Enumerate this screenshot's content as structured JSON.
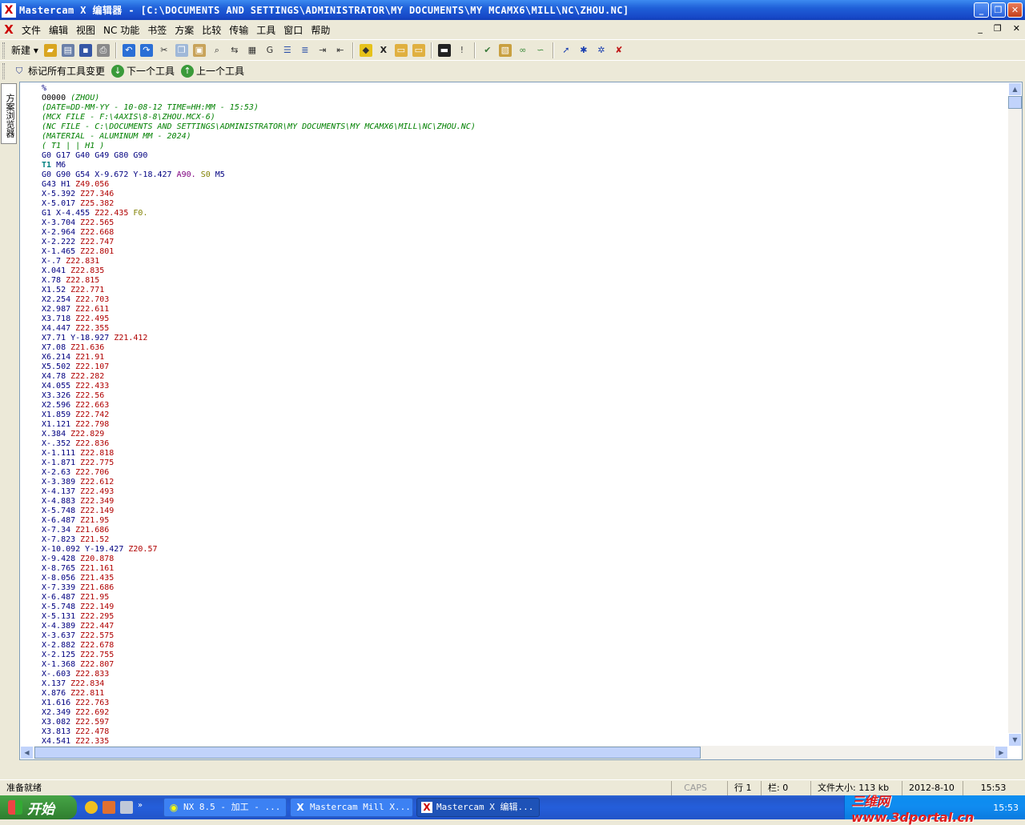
{
  "window": {
    "title": "Mastercam X 编辑器 - [C:\\DOCUMENTS AND SETTINGS\\ADMINISTRATOR\\MY DOCUMENTS\\MY MCAMX6\\MILL\\NC\\ZHOU.NC]",
    "min": "_",
    "restore": "❐",
    "close": "✕"
  },
  "menu": {
    "items": [
      "文件",
      "编辑",
      "视图",
      "NC 功能",
      "书签",
      "方案",
      "比较",
      "传输",
      "工具",
      "窗口",
      "帮助"
    ],
    "mdi": [
      "_",
      "❐",
      "✕"
    ]
  },
  "toolbar": {
    "new_label": "新建"
  },
  "toolbar2": {
    "mark_all": "标记所有工具变更",
    "next_tool": "下一个工具",
    "prev_tool": "上一个工具"
  },
  "side_panel": {
    "tab_label": "方案浏览器"
  },
  "colors": {
    "address": "#000080",
    "xcoord": "#000080",
    "zcoord": "#b00000",
    "comment": "#008000",
    "tool": "#008080",
    "feed": "#808000",
    "arc": "#800080",
    "sword": "#808000"
  },
  "code_lines": [
    [
      [
        "%",
        "#000080"
      ]
    ],
    [
      [
        "O0000 ",
        "#000000"
      ],
      [
        "(ZHOU)",
        "#008000"
      ]
    ],
    [
      [
        "(DATE=DD-MM-YY - 10-08-12 TIME=HH:MM - 15:53)",
        "#008000"
      ]
    ],
    [
      [
        "(MCX FILE - F:\\4AXIS\\8-8\\ZHOU.MCX-6)",
        "#008000"
      ]
    ],
    [
      [
        "(NC FILE - C:\\DOCUMENTS AND SETTINGS\\ADMINISTRATOR\\MY DOCUMENTS\\MY MCAMX6\\MILL\\NC\\ZHOU.NC)",
        "#008000"
      ]
    ],
    [
      [
        "(MATERIAL - ALUMINUM MM - 2024)",
        "#008000"
      ]
    ],
    [
      [
        "( T1 | | H1 )",
        "#008000"
      ]
    ],
    [
      [
        "G0 G17 G40 G49 G80 G90",
        "#000080"
      ]
    ],
    [
      [
        "T1",
        "#008080"
      ],
      [
        " M6",
        "#000080"
      ]
    ],
    [
      [
        "G0 G90 G54 X-9.672 Y-18.427 ",
        "#000080"
      ],
      [
        "A90.",
        "#800080"
      ],
      [
        " S0",
        "#808000"
      ],
      [
        " M5",
        "#000080"
      ]
    ],
    [
      [
        "G43 H1 ",
        "#000080"
      ],
      [
        "Z49.056",
        "#b00000"
      ]
    ],
    [
      [
        "X-5.392 ",
        "#000080"
      ],
      [
        "Z27.346",
        "#b00000"
      ]
    ],
    [
      [
        "X-5.017 ",
        "#000080"
      ],
      [
        "Z25.382",
        "#b00000"
      ]
    ],
    [
      [
        "G1 X-4.455 ",
        "#000080"
      ],
      [
        "Z22.435",
        "#b00000"
      ],
      [
        " F0.",
        "#808000"
      ]
    ],
    [
      [
        "X-3.704 ",
        "#000080"
      ],
      [
        "Z22.565",
        "#b00000"
      ]
    ],
    [
      [
        "X-2.964 ",
        "#000080"
      ],
      [
        "Z22.668",
        "#b00000"
      ]
    ],
    [
      [
        "X-2.222 ",
        "#000080"
      ],
      [
        "Z22.747",
        "#b00000"
      ]
    ],
    [
      [
        "X-1.465 ",
        "#000080"
      ],
      [
        "Z22.801",
        "#b00000"
      ]
    ],
    [
      [
        "X-.7 ",
        "#000080"
      ],
      [
        "Z22.831",
        "#b00000"
      ]
    ],
    [
      [
        "X.041 ",
        "#000080"
      ],
      [
        "Z22.835",
        "#b00000"
      ]
    ],
    [
      [
        "X.78 ",
        "#000080"
      ],
      [
        "Z22.815",
        "#b00000"
      ]
    ],
    [
      [
        "X1.52 ",
        "#000080"
      ],
      [
        "Z22.771",
        "#b00000"
      ]
    ],
    [
      [
        "X2.254 ",
        "#000080"
      ],
      [
        "Z22.703",
        "#b00000"
      ]
    ],
    [
      [
        "X2.987 ",
        "#000080"
      ],
      [
        "Z22.611",
        "#b00000"
      ]
    ],
    [
      [
        "X3.718 ",
        "#000080"
      ],
      [
        "Z22.495",
        "#b00000"
      ]
    ],
    [
      [
        "X4.447 ",
        "#000080"
      ],
      [
        "Z22.355",
        "#b00000"
      ]
    ],
    [
      [
        "X7.71 Y-18.927 ",
        "#000080"
      ],
      [
        "Z21.412",
        "#b00000"
      ]
    ],
    [
      [
        "X7.08 ",
        "#000080"
      ],
      [
        "Z21.636",
        "#b00000"
      ]
    ],
    [
      [
        "X6.214 ",
        "#000080"
      ],
      [
        "Z21.91",
        "#b00000"
      ]
    ],
    [
      [
        "X5.502 ",
        "#000080"
      ],
      [
        "Z22.107",
        "#b00000"
      ]
    ],
    [
      [
        "X4.78 ",
        "#000080"
      ],
      [
        "Z22.282",
        "#b00000"
      ]
    ],
    [
      [
        "X4.055 ",
        "#000080"
      ],
      [
        "Z22.433",
        "#b00000"
      ]
    ],
    [
      [
        "X3.326 ",
        "#000080"
      ],
      [
        "Z22.56",
        "#b00000"
      ]
    ],
    [
      [
        "X2.596 ",
        "#000080"
      ],
      [
        "Z22.663",
        "#b00000"
      ]
    ],
    [
      [
        "X1.859 ",
        "#000080"
      ],
      [
        "Z22.742",
        "#b00000"
      ]
    ],
    [
      [
        "X1.121 ",
        "#000080"
      ],
      [
        "Z22.798",
        "#b00000"
      ]
    ],
    [
      [
        "X.384 ",
        "#000080"
      ],
      [
        "Z22.829",
        "#b00000"
      ]
    ],
    [
      [
        "X-.352 ",
        "#000080"
      ],
      [
        "Z22.836",
        "#b00000"
      ]
    ],
    [
      [
        "X-1.111 ",
        "#000080"
      ],
      [
        "Z22.818",
        "#b00000"
      ]
    ],
    [
      [
        "X-1.871 ",
        "#000080"
      ],
      [
        "Z22.775",
        "#b00000"
      ]
    ],
    [
      [
        "X-2.63 ",
        "#000080"
      ],
      [
        "Z22.706",
        "#b00000"
      ]
    ],
    [
      [
        "X-3.389 ",
        "#000080"
      ],
      [
        "Z22.612",
        "#b00000"
      ]
    ],
    [
      [
        "X-4.137 ",
        "#000080"
      ],
      [
        "Z22.493",
        "#b00000"
      ]
    ],
    [
      [
        "X-4.883 ",
        "#000080"
      ],
      [
        "Z22.349",
        "#b00000"
      ]
    ],
    [
      [
        "X-5.748 ",
        "#000080"
      ],
      [
        "Z22.149",
        "#b00000"
      ]
    ],
    [
      [
        "X-6.487 ",
        "#000080"
      ],
      [
        "Z21.95",
        "#b00000"
      ]
    ],
    [
      [
        "X-7.34 ",
        "#000080"
      ],
      [
        "Z21.686",
        "#b00000"
      ]
    ],
    [
      [
        "X-7.823 ",
        "#000080"
      ],
      [
        "Z21.52",
        "#b00000"
      ]
    ],
    [
      [
        "X-10.092 Y-19.427 ",
        "#000080"
      ],
      [
        "Z20.57",
        "#b00000"
      ]
    ],
    [
      [
        "X-9.428 ",
        "#000080"
      ],
      [
        "Z20.878",
        "#b00000"
      ]
    ],
    [
      [
        "X-8.765 ",
        "#000080"
      ],
      [
        "Z21.161",
        "#b00000"
      ]
    ],
    [
      [
        "X-8.056 ",
        "#000080"
      ],
      [
        "Z21.435",
        "#b00000"
      ]
    ],
    [
      [
        "X-7.339 ",
        "#000080"
      ],
      [
        "Z21.686",
        "#b00000"
      ]
    ],
    [
      [
        "X-6.487 ",
        "#000080"
      ],
      [
        "Z21.95",
        "#b00000"
      ]
    ],
    [
      [
        "X-5.748 ",
        "#000080"
      ],
      [
        "Z22.149",
        "#b00000"
      ]
    ],
    [
      [
        "X-5.131 ",
        "#000080"
      ],
      [
        "Z22.295",
        "#b00000"
      ]
    ],
    [
      [
        "X-4.389 ",
        "#000080"
      ],
      [
        "Z22.447",
        "#b00000"
      ]
    ],
    [
      [
        "X-3.637 ",
        "#000080"
      ],
      [
        "Z22.575",
        "#b00000"
      ]
    ],
    [
      [
        "X-2.882 ",
        "#000080"
      ],
      [
        "Z22.678",
        "#b00000"
      ]
    ],
    [
      [
        "X-2.125 ",
        "#000080"
      ],
      [
        "Z22.755",
        "#b00000"
      ]
    ],
    [
      [
        "X-1.368 ",
        "#000080"
      ],
      [
        "Z22.807",
        "#b00000"
      ]
    ],
    [
      [
        "X-.603 ",
        "#000080"
      ],
      [
        "Z22.833",
        "#b00000"
      ]
    ],
    [
      [
        "X.137 ",
        "#000080"
      ],
      [
        "Z22.834",
        "#b00000"
      ]
    ],
    [
      [
        "X.876 ",
        "#000080"
      ],
      [
        "Z22.811",
        "#b00000"
      ]
    ],
    [
      [
        "X1.616 ",
        "#000080"
      ],
      [
        "Z22.763",
        "#b00000"
      ]
    ],
    [
      [
        "X2.349 ",
        "#000080"
      ],
      [
        "Z22.692",
        "#b00000"
      ]
    ],
    [
      [
        "X3.082 ",
        "#000080"
      ],
      [
        "Z22.597",
        "#b00000"
      ]
    ],
    [
      [
        "X3.813 ",
        "#000080"
      ],
      [
        "Z22.478",
        "#b00000"
      ]
    ],
    [
      [
        "X4.541 ",
        "#000080"
      ],
      [
        "Z22.335",
        "#b00000"
      ]
    ]
  ],
  "status": {
    "ready": "准备就绪",
    "caps": "CAPS",
    "row": "行 1",
    "col": "栏: 0",
    "filesize": "文件大小: 113 kb",
    "date": "2012-8-10",
    "time": "15:53"
  },
  "taskbar": {
    "start": "开始",
    "tasks": [
      "NX 8.5 - 加工 - ...",
      "Mastercam Mill X...",
      "Mastercam X 编辑..."
    ],
    "watermark": "三维网www.3dportal.cn",
    "clock": "15:53"
  }
}
